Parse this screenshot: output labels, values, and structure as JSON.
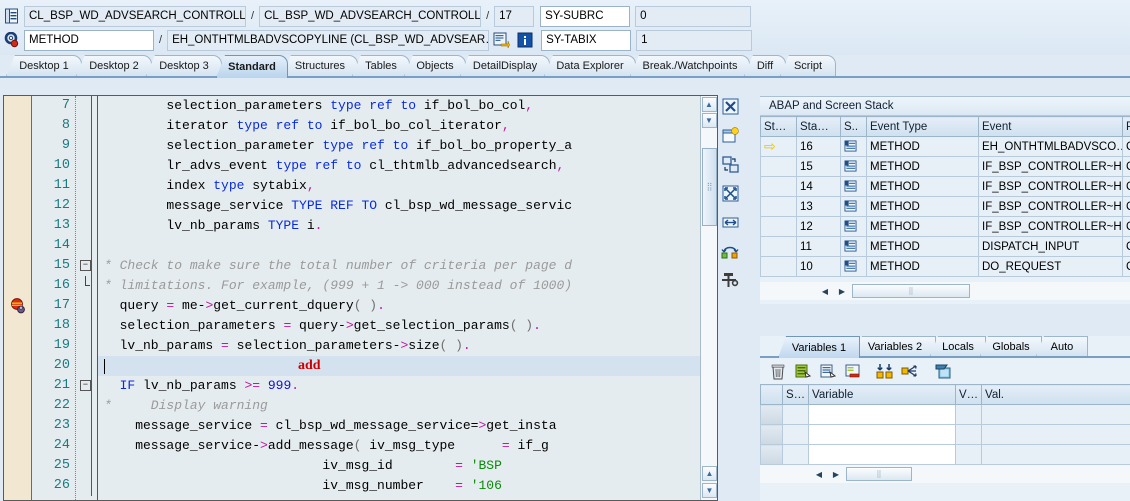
{
  "header": {
    "icon_row1": "program-stack-icon",
    "icon_row2": "settings-gear-icon",
    "row1": {
      "program": "CL_BSP_WD_ADVSEARCH_CONTROLLE…",
      "include": "CL_BSP_WD_ADVSEARCH_CONTROLLE…",
      "line": "17",
      "sy_label": "SY-SUBRC",
      "sy_value": "0"
    },
    "row2": {
      "event_type": "METHOD",
      "event": "EH_ONTHTMLBADVSCOPYLINE (CL_BSP_WD_ADVSEAR…",
      "icon_goto": "goto-source-icon",
      "icon_info": "information-icon",
      "sy_label": "SY-TABIX",
      "sy_value": "1"
    }
  },
  "tabs": [
    {
      "label": "Desktop 1",
      "selected": false
    },
    {
      "label": "Desktop 2",
      "selected": false
    },
    {
      "label": "Desktop 3",
      "selected": false
    },
    {
      "label": "Standard",
      "selected": true
    },
    {
      "label": "Structures",
      "selected": false
    },
    {
      "label": "Tables",
      "selected": false
    },
    {
      "label": "Objects",
      "selected": false
    },
    {
      "label": "DetailDisplay",
      "selected": false
    },
    {
      "label": "Data Explorer",
      "selected": false
    },
    {
      "label": "Break./Watchpoints",
      "selected": false
    },
    {
      "label": "Diff",
      "selected": false
    },
    {
      "label": "Script",
      "selected": false
    }
  ],
  "editor": {
    "annotation": "add",
    "breakpoint_icon": "breakpoint-icon",
    "breakpoint_line": 17,
    "current_line": 20,
    "lines": [
      {
        "n": "7",
        "segments": [
          {
            "t": "        selection_parameters ",
            "c": ""
          },
          {
            "t": "type ref to ",
            "c": "kw"
          },
          {
            "t": "if_bol_bo_col",
            "c": ""
          },
          {
            "t": ",",
            "c": "op"
          }
        ]
      },
      {
        "n": "8",
        "segments": [
          {
            "t": "        iterator ",
            "c": ""
          },
          {
            "t": "type ref to ",
            "c": "kw"
          },
          {
            "t": "if_bol_bo_col_iterator",
            "c": ""
          },
          {
            "t": ",",
            "c": "op"
          }
        ]
      },
      {
        "n": "9",
        "segments": [
          {
            "t": "        selection_parameter ",
            "c": ""
          },
          {
            "t": "type ref to ",
            "c": "kw"
          },
          {
            "t": "if_bol_bo_property_a",
            "c": ""
          }
        ]
      },
      {
        "n": "10",
        "segments": [
          {
            "t": "        lr_advs_event ",
            "c": ""
          },
          {
            "t": "type ref to ",
            "c": "kw"
          },
          {
            "t": "cl_thtmlb_advancedsearch",
            "c": ""
          },
          {
            "t": ",",
            "c": "op"
          }
        ]
      },
      {
        "n": "11",
        "segments": [
          {
            "t": "        index ",
            "c": ""
          },
          {
            "t": "type ",
            "c": "kw"
          },
          {
            "t": "sytabix",
            "c": ""
          },
          {
            "t": ",",
            "c": "op"
          }
        ]
      },
      {
        "n": "12",
        "segments": [
          {
            "t": "        message_service ",
            "c": ""
          },
          {
            "t": "TYPE REF TO ",
            "c": "kw"
          },
          {
            "t": "cl_bsp_wd_message_servic",
            "c": ""
          }
        ]
      },
      {
        "n": "13",
        "segments": [
          {
            "t": "        lv_nb_params ",
            "c": ""
          },
          {
            "t": "TYPE ",
            "c": "kw"
          },
          {
            "t": "i",
            "c": ""
          },
          {
            "t": ".",
            "c": "op"
          }
        ]
      },
      {
        "n": "14",
        "segments": []
      },
      {
        "n": "15",
        "segments": [
          {
            "t": "* Check to make sure the total number of criteria per page d",
            "c": "cmt"
          }
        ],
        "fold": "minus"
      },
      {
        "n": "16",
        "segments": [
          {
            "t": "* limitations. For example, (999 + 1 -> 000 instead of 1000)",
            "c": "cmt"
          }
        ],
        "foldend": true
      },
      {
        "n": "17",
        "segments": [
          {
            "t": "  query ",
            "c": ""
          },
          {
            "t": "=",
            "c": "op"
          },
          {
            "t": " me-",
            "c": ""
          },
          {
            "t": ">",
            "c": "op"
          },
          {
            "t": "get_current_dquery",
            "c": ""
          },
          {
            "t": "( )",
            "c": "pnc"
          },
          {
            "t": ".",
            "c": "op"
          }
        ]
      },
      {
        "n": "18",
        "segments": [
          {
            "t": "  selection_parameters ",
            "c": ""
          },
          {
            "t": "=",
            "c": "op"
          },
          {
            "t": " query-",
            "c": ""
          },
          {
            "t": ">",
            "c": "op"
          },
          {
            "t": "get_selection_params",
            "c": ""
          },
          {
            "t": "( )",
            "c": "pnc"
          },
          {
            "t": ".",
            "c": "op"
          }
        ]
      },
      {
        "n": "19",
        "segments": [
          {
            "t": "  lv_nb_params ",
            "c": ""
          },
          {
            "t": "=",
            "c": "op"
          },
          {
            "t": " selection_parameters-",
            "c": ""
          },
          {
            "t": ">",
            "c": "op"
          },
          {
            "t": "size",
            "c": ""
          },
          {
            "t": "( )",
            "c": "pnc"
          },
          {
            "t": ".",
            "c": "op"
          }
        ]
      },
      {
        "n": "20",
        "segments": [],
        "current": true
      },
      {
        "n": "21",
        "segments": [
          {
            "t": "  ",
            "c": ""
          },
          {
            "t": "IF",
            "c": "kw"
          },
          {
            "t": " lv_nb_params ",
            "c": ""
          },
          {
            "t": ">=",
            "c": "op"
          },
          {
            "t": " ",
            "c": ""
          },
          {
            "t": "999",
            "c": "num"
          },
          {
            "t": ".",
            "c": "op"
          }
        ],
        "fold": "minus"
      },
      {
        "n": "22",
        "segments": [
          {
            "t": "*     Display warning",
            "c": "cmt"
          }
        ]
      },
      {
        "n": "23",
        "segments": [
          {
            "t": "    message_service ",
            "c": ""
          },
          {
            "t": "=",
            "c": "op"
          },
          {
            "t": " cl_bsp_wd_message_service=",
            "c": ""
          },
          {
            "t": ">",
            "c": "op"
          },
          {
            "t": "get_insta",
            "c": ""
          }
        ]
      },
      {
        "n": "24",
        "segments": [
          {
            "t": "    message_service-",
            "c": ""
          },
          {
            "t": ">",
            "c": "op"
          },
          {
            "t": "add_message",
            "c": ""
          },
          {
            "t": "(",
            "c": "pnc"
          },
          {
            "t": " iv_msg_type      ",
            "c": ""
          },
          {
            "t": "=",
            "c": "op"
          },
          {
            "t": " if_g",
            "c": ""
          }
        ]
      },
      {
        "n": "25",
        "segments": [
          {
            "t": "                            iv_msg_id        ",
            "c": ""
          },
          {
            "t": "=",
            "c": "op"
          },
          {
            "t": " ",
            "c": ""
          },
          {
            "t": "'BSP",
            "c": "str"
          }
        ]
      },
      {
        "n": "26",
        "segments": [
          {
            "t": "                            iv_msg_number    ",
            "c": ""
          },
          {
            "t": "=",
            "c": "op"
          },
          {
            "t": " ",
            "c": ""
          },
          {
            "t": "'106",
            "c": "str"
          }
        ]
      }
    ],
    "side_icons": [
      "close-window-icon",
      "new-window-icon",
      "detach-window-icon",
      "fullscreen-icon",
      "resize-width-icon",
      "swap-layout-icon",
      "layout-tools-icon"
    ]
  },
  "stack_panel": {
    "title": "ABAP and Screen Stack",
    "columns": [
      "St…",
      "Sta…",
      "S..",
      "Event Type",
      "Event",
      "Prog"
    ],
    "rows": [
      {
        "cur": true,
        "stack": "16",
        "icon": "method-icon",
        "event_type": "METHOD",
        "event": "EH_ONTHTMLBADVSCO…",
        "prog": "CL_B"
      },
      {
        "cur": false,
        "stack": "15",
        "icon": "method-icon",
        "event_type": "METHOD",
        "event": "IF_BSP_CONTROLLER~H…",
        "prog": "CL_B"
      },
      {
        "cur": false,
        "stack": "14",
        "icon": "method-icon",
        "event_type": "METHOD",
        "event": "IF_BSP_CONTROLLER~H…",
        "prog": "CL_B"
      },
      {
        "cur": false,
        "stack": "13",
        "icon": "method-icon",
        "event_type": "METHOD",
        "event": "IF_BSP_CONTROLLER~H…",
        "prog": "CL_B"
      },
      {
        "cur": false,
        "stack": "12",
        "icon": "method-icon",
        "event_type": "METHOD",
        "event": "IF_BSP_CONTROLLER~H…",
        "prog": "CL_B"
      },
      {
        "cur": false,
        "stack": "11",
        "icon": "method-icon",
        "event_type": "METHOD",
        "event": "DISPATCH_INPUT",
        "prog": "CL_B"
      },
      {
        "cur": false,
        "stack": "10",
        "icon": "method-icon",
        "event_type": "METHOD",
        "event": "DO_REQUEST",
        "prog": "CL_B"
      }
    ]
  },
  "variables_panel": {
    "tabs": [
      {
        "label": "Variables 1",
        "selected": true
      },
      {
        "label": "Variables 2",
        "selected": false
      },
      {
        "label": "Locals",
        "selected": false
      },
      {
        "label": "Globals",
        "selected": false
      },
      {
        "label": "Auto",
        "selected": false
      }
    ],
    "toolbar": [
      "delete-icon",
      "copy-to-list-icon",
      "copy-row-icon",
      "remove-row-icon",
      "collapse-all-icon",
      "expand-node-icon",
      "clipboard-paste-icon"
    ],
    "columns": [
      "S…",
      "Variable",
      "V…",
      "Val."
    ],
    "rows": [
      {
        "s": "",
        "variable": "",
        "v": "",
        "val": ""
      },
      {
        "s": "",
        "variable": "",
        "v": "",
        "val": ""
      },
      {
        "s": "",
        "variable": "",
        "v": "",
        "val": ""
      }
    ]
  },
  "colors": {
    "accent": "#7a9fc4",
    "panel_bg": "#e9f1f8",
    "editor_bg": "#e5ecef",
    "breakpoint_gutter": "#f2e8d2",
    "annotation_red": "#cc0000",
    "keyword_blue": "#0a2bdd",
    "comment_gray": "#9a9a9a",
    "string_green": "#0a8a0a",
    "linenum_teal": "#1a7a82"
  }
}
